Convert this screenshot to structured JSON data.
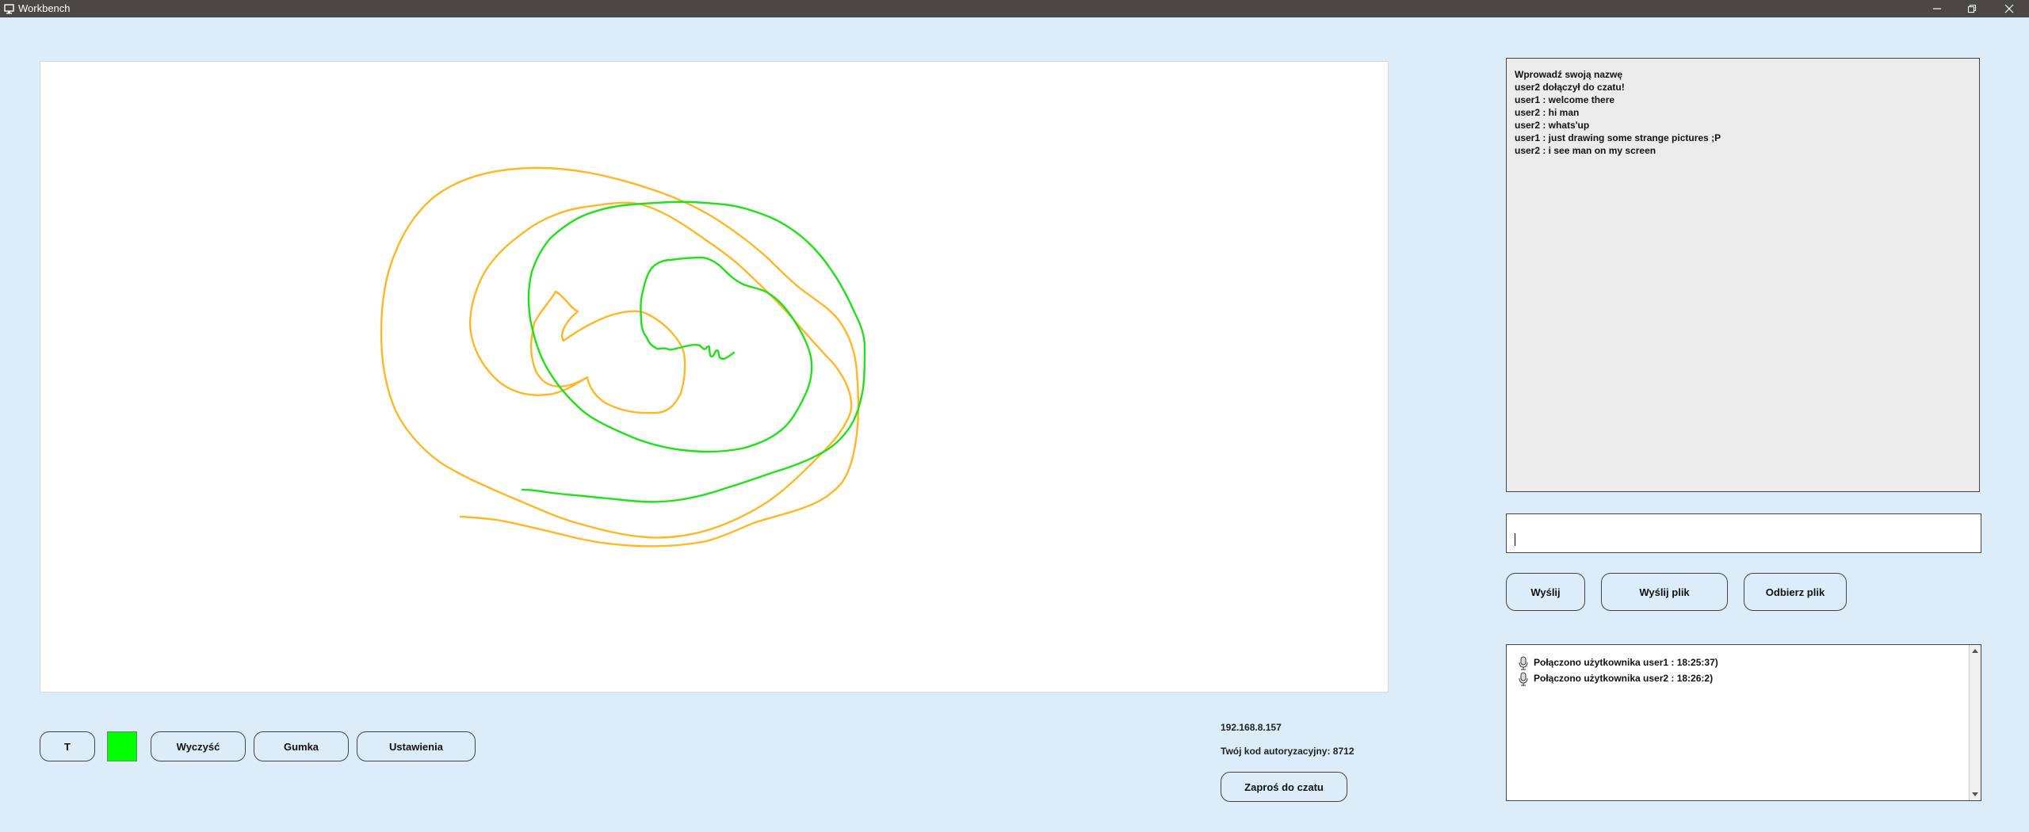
{
  "window": {
    "title": "Workbench"
  },
  "toolbar": {
    "text_tool_label": "T",
    "current_color": "#00ff00",
    "clear_label": "Wyczyść",
    "eraser_label": "Gumka",
    "settings_label": "Ustawienia"
  },
  "connection": {
    "ip": "192.168.8.157",
    "auth_code": "Twój kod autoryzacyjny: 8712",
    "invite_label": "Zaproś do czatu"
  },
  "chat": {
    "messages": [
      "Wprowadź swoją nazwę",
      "user2 dołączył do czatu!",
      "user1 : welcome there",
      "user2 : hi man",
      "user2 : whats'up",
      "user1 : just drawing some strange pictures ;P",
      "user2 : i see man on my screen"
    ],
    "input_value": "",
    "send_label": "Wyślij",
    "send_file_label": "Wyślij plik",
    "receive_file_label": "Odbierz plik"
  },
  "users": {
    "entries": [
      "Połączono użytkownika user1 : 18:25:37)",
      "Połączono użytkownika user2 : 18:26:2)"
    ],
    "icon": "microphone-icon"
  },
  "drawing": {
    "stroke_colors": [
      "#ffb726",
      "#22e01a"
    ]
  }
}
